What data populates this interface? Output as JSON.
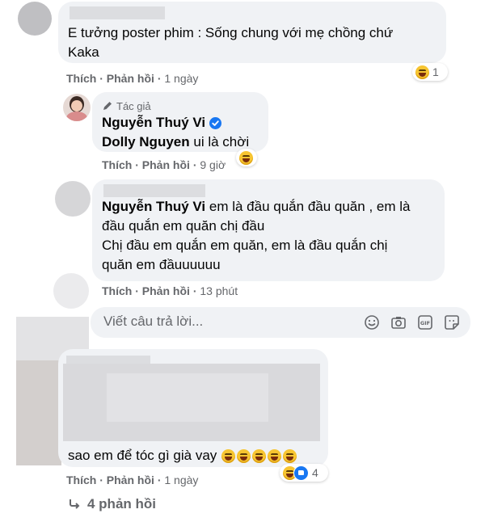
{
  "comment1": {
    "text": "E tưởng poster phim : Sống chung với mẹ chồng chứ Kaka",
    "line1": "E tưởng poster phim : Sống chung với mẹ chồng chứ",
    "line2": "Kaka",
    "like_label": "Thích",
    "reply_label": "Phản hồi",
    "time": "1 ngày",
    "reaction_count": "1"
  },
  "reply1": {
    "author_badge": "Tác giả",
    "author": "Nguyễn Thuý Vi",
    "mention": "Dolly Nguyen",
    "text": "ui là chời",
    "like_label": "Thích",
    "reply_label": "Phản hồi",
    "time": "9 giờ"
  },
  "reply2": {
    "mention": "Nguyễn Thuý Vi",
    "line1": "em là đầu quắn đầu quăn , em là",
    "line2": "đầu quắn em quăn chị đầu",
    "line3": "Chị đầu em quắn em quăn, em là đầu quắn chị",
    "line4": "quăn em đầuuuuuu",
    "like_label": "Thích",
    "reply_label": "Phản hồi",
    "time": "13 phút"
  },
  "reply_input": {
    "placeholder": "Viết câu trả lời..."
  },
  "comment2": {
    "text": "sao em để tóc gì già vay",
    "like_label": "Thích",
    "reply_label": "Phản hồi",
    "time": "1 ngày",
    "reaction_count": "4"
  },
  "view_replies": {
    "label": "4 phản hồi"
  },
  "separator": "·"
}
